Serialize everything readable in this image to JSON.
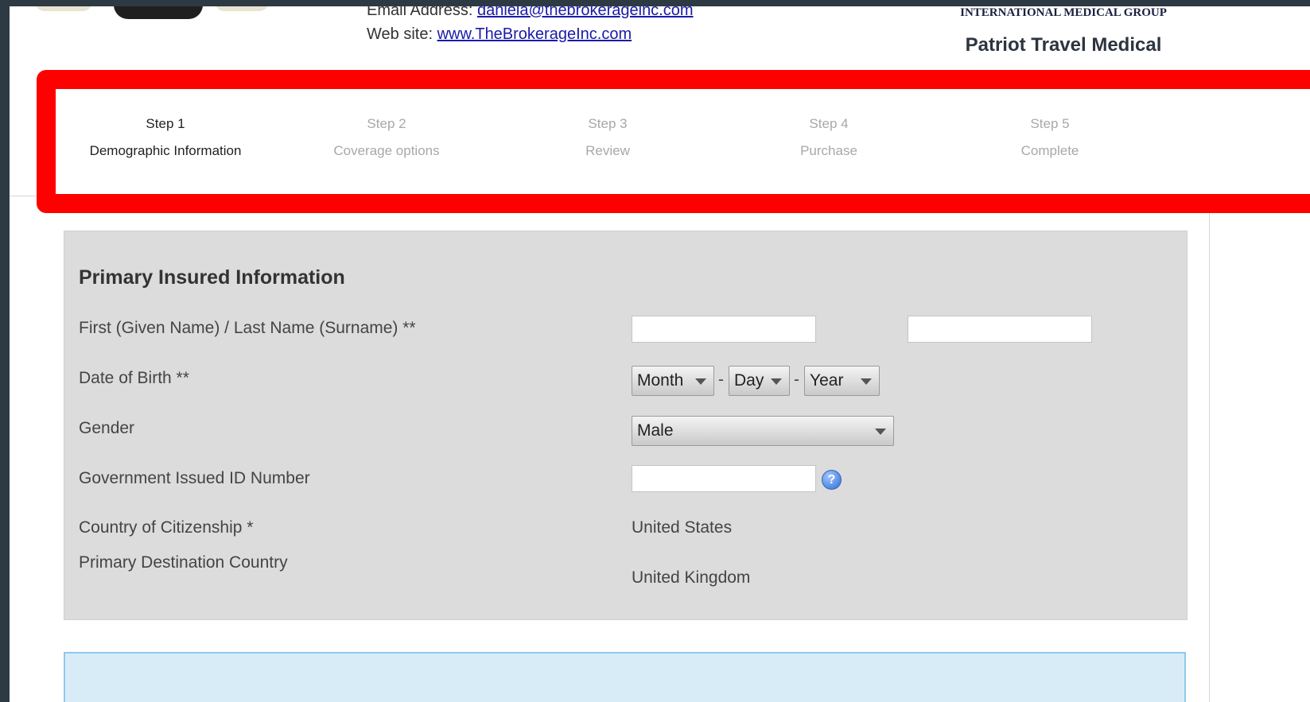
{
  "header": {
    "email_label": "Email Address: ",
    "email_value": "daniela@thebrokerageinc.com",
    "website_label": "Web site: ",
    "website_value": "www.TheBrokerageInc.com",
    "brand_group": "INTERNATIONAL MEDICAL GROUP",
    "brand_product": "Patriot Travel Medical"
  },
  "steps": [
    {
      "num": "Step 1",
      "label": "Demographic Information",
      "active": true
    },
    {
      "num": "Step 2",
      "label": "Coverage options",
      "active": false
    },
    {
      "num": "Step 3",
      "label": "Review",
      "active": false
    },
    {
      "num": "Step 4",
      "label": "Purchase",
      "active": false
    },
    {
      "num": "Step 5",
      "label": "Complete",
      "active": false
    }
  ],
  "form": {
    "title": "Primary Insured Information",
    "name_label": "First (Given Name) / Last Name (Surname) **",
    "first_name_value": "",
    "last_name_value": "",
    "dob_label": "Date of Birth **",
    "dob_month": "Month",
    "dob_day": "Day",
    "dob_year": "Year",
    "dob_separator": "-",
    "gender_label": "Gender",
    "gender_value": "Male",
    "gov_id_label": "Government Issued ID Number",
    "gov_id_value": "",
    "help_glyph": "?",
    "citizenship_label": "Country of Citizenship *",
    "citizenship_value": "United States",
    "destination_label": "Primary Destination Country",
    "destination_value": "United Kingdom"
  },
  "colors": {
    "highlight": "#ff0000",
    "panel": "#dcdcdc",
    "info_box": "#d8ecf8",
    "link": "#1a1aa8"
  }
}
